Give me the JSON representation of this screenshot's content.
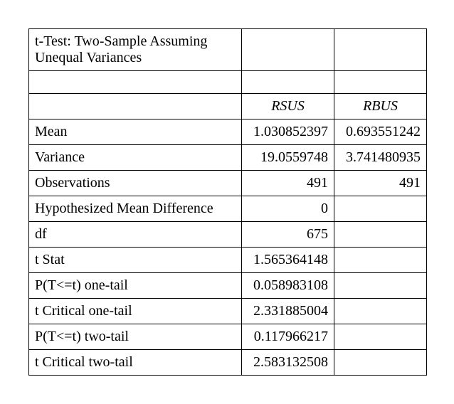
{
  "title": "t-Test: Two-Sample Assuming Unequal Variances",
  "columns": {
    "c1": "RSUS",
    "c2": "RBUS"
  },
  "rows": {
    "mean": {
      "label": "Mean",
      "c1": "1.030852397",
      "c2": "0.693551242"
    },
    "variance": {
      "label": "Variance",
      "c1": "19.0559748",
      "c2": "3.741480935"
    },
    "observations": {
      "label": "Observations",
      "c1": "491",
      "c2": "491"
    },
    "hyp_mean_diff": {
      "label": "Hypothesized Mean Difference",
      "c1": "0",
      "c2": ""
    },
    "df": {
      "label": "df",
      "c1": "675",
      "c2": ""
    },
    "t_stat": {
      "label": "t Stat",
      "c1": "1.565364148",
      "c2": ""
    },
    "p_one_tail": {
      "label": "P(T<=t) one-tail",
      "c1": "0.058983108",
      "c2": ""
    },
    "t_crit_one": {
      "label": "t Critical one-tail",
      "c1": "2.331885004",
      "c2": ""
    },
    "p_two_tail": {
      "label": "P(T<=t) two-tail",
      "c1": "0.117966217",
      "c2": ""
    },
    "t_crit_two": {
      "label": "t Critical two-tail",
      "c1": "2.583132508",
      "c2": ""
    }
  }
}
